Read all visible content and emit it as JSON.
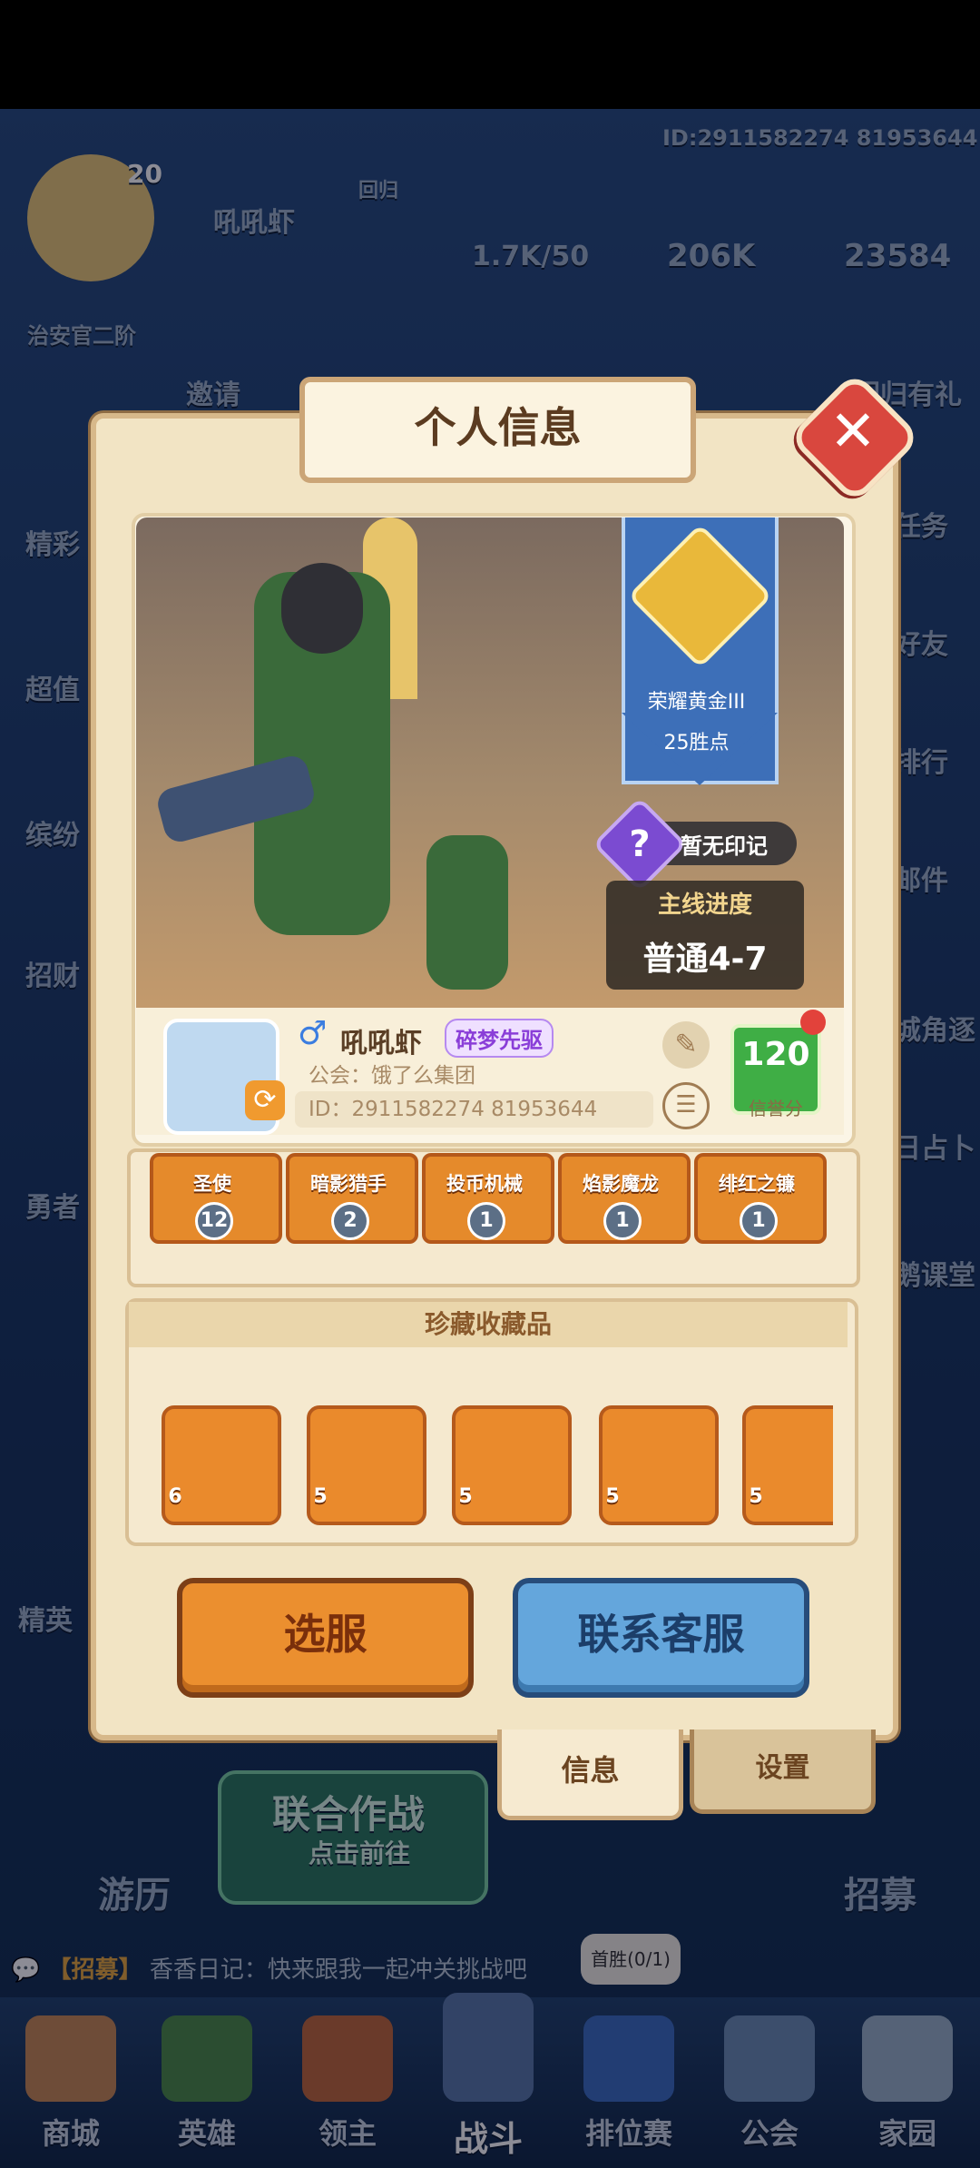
{
  "background": {
    "id_text": "ID:2911582274 81953644",
    "player_name": "吼吼虾",
    "player_level": "20",
    "rank_badge": "治安官二阶",
    "return_label": "回归",
    "stamina": "1.7K/50",
    "gold": "206K",
    "gems": "23584",
    "invite_label": "邀请",
    "return_gift": "回归有礼",
    "left_menu": [
      "精彩",
      "超值",
      "缤纷",
      "招财",
      "勇者"
    ],
    "right_menu": [
      "任务",
      "好友",
      "排行",
      "邮件",
      "城角逐",
      "日占卜",
      "鹅课堂"
    ],
    "battle_label": "联合作战",
    "battle_sub": "点击前往",
    "travel_label": "游历",
    "recruit_label": "招募",
    "elite_label": "精英",
    "first_win": "首胜(0/1)",
    "chat_tag": "【招募】",
    "chat_text": "香香日记：快来跟我一起冲关挑战吧"
  },
  "dialog": {
    "title": "个人信息",
    "rank_name": "荣耀黄金III",
    "rank_points": "25胜点",
    "emblem_text": "暂无印记",
    "progress_label": "主线进度",
    "progress_value": "普通4-7",
    "gender_symbol": "♂",
    "player_name": "吼吼虾",
    "player_tag": "碎梦先驱",
    "guild": "公会：饿了么集团",
    "player_id": "ID：2911582274 81953644",
    "credit_value": "120",
    "credit_label": "信誉分",
    "heroes": [
      {
        "name": "圣使",
        "level": "12"
      },
      {
        "name": "暗影猎手",
        "level": "2"
      },
      {
        "name": "投币机械",
        "level": "1"
      },
      {
        "name": "焰影魔龙",
        "level": "1"
      },
      {
        "name": "绯红之镰",
        "level": "1"
      }
    ],
    "collection_title": "珍藏收藏品",
    "collection_items": [
      {
        "count": "6"
      },
      {
        "count": "5"
      },
      {
        "count": "5"
      },
      {
        "count": "5"
      },
      {
        "count": "5"
      }
    ],
    "select_server": "选服",
    "contact_service": "联系客服",
    "tab_info": "信息",
    "tab_settings": "设置"
  },
  "navbar": {
    "items": [
      "商城",
      "英雄",
      "领主",
      "战斗",
      "排位赛",
      "公会",
      "家园"
    ]
  },
  "colors": {
    "panel": "#f2e4c4",
    "select_button": "#eb8f2f",
    "contact_button": "#64a6dc",
    "close_button": "#d9473e"
  }
}
